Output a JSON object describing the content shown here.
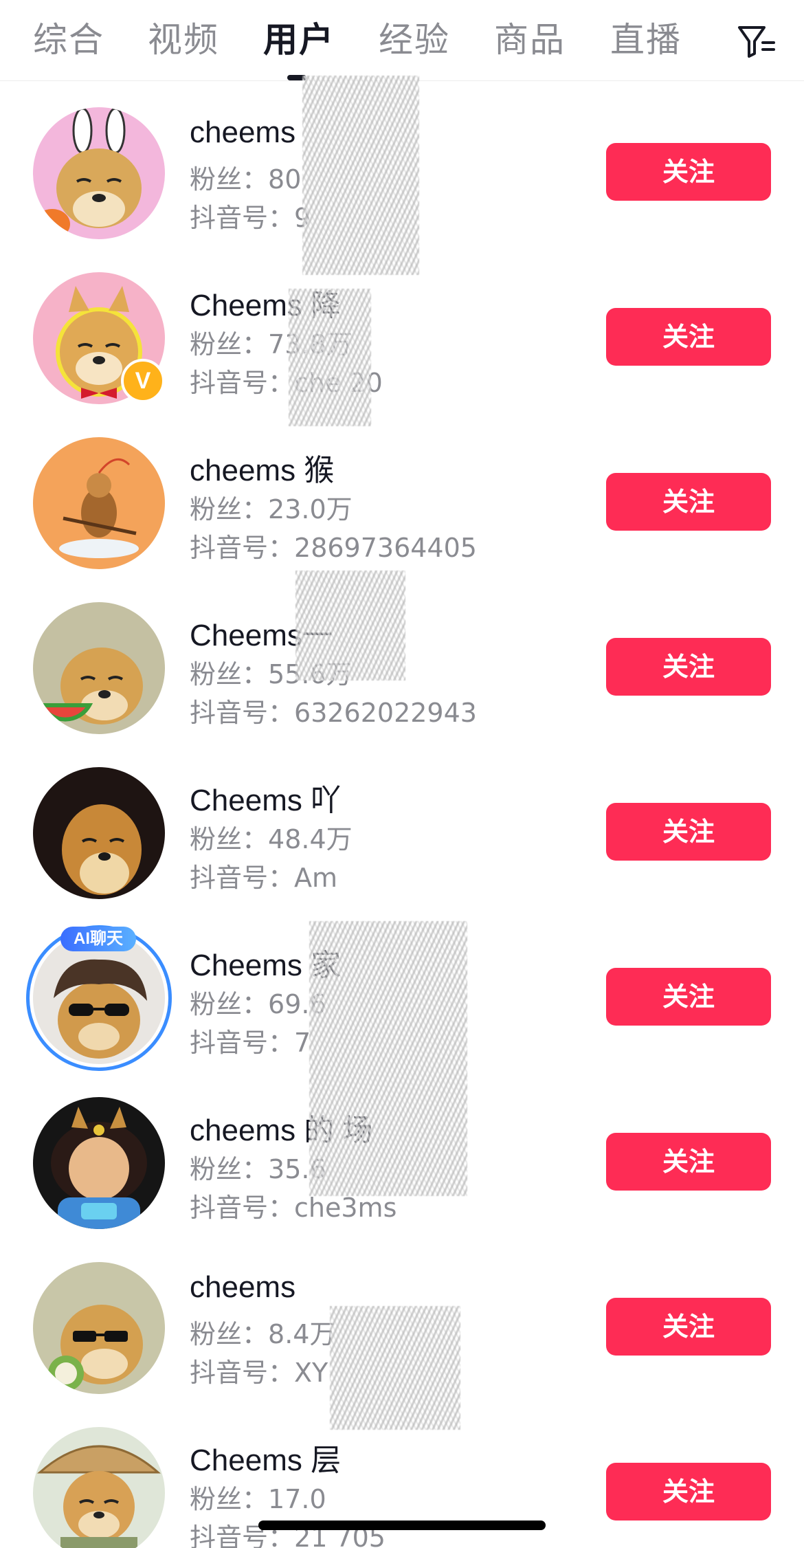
{
  "tabs": [
    "综合",
    "视频",
    "用户",
    "经验",
    "商品",
    "直播"
  ],
  "active_tab": "用户",
  "follow_label": "关注",
  "fans_prefix": "粉丝：",
  "id_prefix": "抖音号：",
  "ai_badge": "AI聊天",
  "verify_badge": "V",
  "colors": {
    "accent": "#fe2c55",
    "text_primary": "#161823",
    "text_secondary": "#8a8b91"
  },
  "users": [
    {
      "name": "cheems",
      "fans": "80",
      "id": "9"
    },
    {
      "name": "Cheems 降",
      "fans": "73.8万",
      "id": "che 20"
    },
    {
      "name": "cheems 猴",
      "fans": "23.0万",
      "id": "28697364405"
    },
    {
      "name": "Cheems一",
      "fans": "55.6万",
      "id": "63262022943"
    },
    {
      "name": "Cheems 吖",
      "fans": "48.4万",
      "id": "Am"
    },
    {
      "name": "Cheems 家",
      "fans": "69.6",
      "id": "7"
    },
    {
      "name": "cheems 的 场",
      "fans": "35.6",
      "id": "che3ms"
    },
    {
      "name": "cheems",
      "fans": "8.4万",
      "id": "XY"
    },
    {
      "name": "Cheems 层",
      "fans": "17.0",
      "id": "21 705"
    }
  ]
}
